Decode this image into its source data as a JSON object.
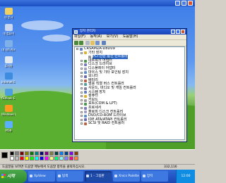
{
  "desktop": {
    "icons": [
      {
        "label": "내 문서",
        "color": "#f0d060"
      },
      {
        "label": "내 컴퓨터",
        "color": "#c9d7f0"
      },
      {
        "label": "내 네트워크",
        "color": "#7fb0e8"
      },
      {
        "label": "휴지통",
        "color": "#e0e8f0"
      },
      {
        "label": "Internet Explorer",
        "color": "#3d8ce0"
      },
      {
        "label": "Outlook Express",
        "color": "#4aa0e0"
      },
      {
        "label": "Windows Media",
        "color": "#ff9a20"
      },
      {
        "label": "MSN",
        "color": "#5ab0ff"
      }
    ]
  },
  "device_manager": {
    "title": "장치 관리자",
    "menu": [
      "파일(F)",
      "동작(A)",
      "보기(V)",
      "도움말(H)"
    ],
    "tree": [
      {
        "label": "CRSAMZA-D8D09",
        "level": 0,
        "expanded": true
      },
      {
        "label": "기타 장치",
        "level": 1,
        "expanded": true
      },
      {
        "label": "PCI 단순 통신 컨트롤러",
        "level": 2,
        "selected": true
      },
      {
        "label": "네트워크 어댑터",
        "level": 1
      },
      {
        "label": "디스크 드라이브",
        "level": 1
      },
      {
        "label": "디스플레이 어댑터",
        "level": 1
      },
      {
        "label": "마우스 및 기타 포인팅 장치",
        "level": 1
      },
      {
        "label": "모니터",
        "level": 1
      },
      {
        "label": "배터리",
        "level": 1
      },
      {
        "label": "범용 직렬 버스 컨트롤러",
        "level": 1
      },
      {
        "label": "사운드, 비디오 및 게임 컨트롤러",
        "level": 1
      },
      {
        "label": "시스템 장치",
        "level": 1
      },
      {
        "label": "컴퓨터",
        "level": 1
      },
      {
        "label": "키보드",
        "level": 1
      },
      {
        "label": "포트(COM & LPT)",
        "level": 1
      },
      {
        "label": "프로세서",
        "level": 1
      },
      {
        "label": "플로피 디스크 컨트롤러",
        "level": 1
      },
      {
        "label": "DVD/CD-ROM 드라이브",
        "level": 1
      },
      {
        "label": "IDE ATA/ATAPI 컨트롤러",
        "level": 1
      },
      {
        "label": "SCSI 및 RAID 컨트롤러",
        "level": 1
      }
    ]
  },
  "palette": {
    "colors": [
      "#000000",
      "#808080",
      "#800000",
      "#808000",
      "#008000",
      "#008080",
      "#000080",
      "#800080",
      "#808040",
      "#004040",
      "#0080ff",
      "#004080",
      "#8000ff",
      "#804000",
      "#ffffff",
      "#c0c0c0",
      "#ff0000",
      "#ffff00",
      "#00ff00",
      "#00ffff",
      "#0000ff",
      "#ff00ff",
      "#ffff80",
      "#00ff80",
      "#80ffff",
      "#8080ff",
      "#ff0080",
      "#ff8040"
    ]
  },
  "status_bar": {
    "message": "도움말을 보려면 도움말 메뉴에서 도움말 항목을 클릭하십시오.",
    "coords": "332,116"
  },
  "taskbar": {
    "start_label": "시작",
    "buttons": [
      {
        "label": "XpView",
        "active": false
      },
      {
        "label": "탐색",
        "active": false
      },
      {
        "label": "1 - 그림판",
        "active": true
      },
      {
        "label": "Xnics Palette",
        "active": false
      },
      {
        "label": "장치",
        "active": false
      }
    ],
    "clock": "12:00"
  }
}
